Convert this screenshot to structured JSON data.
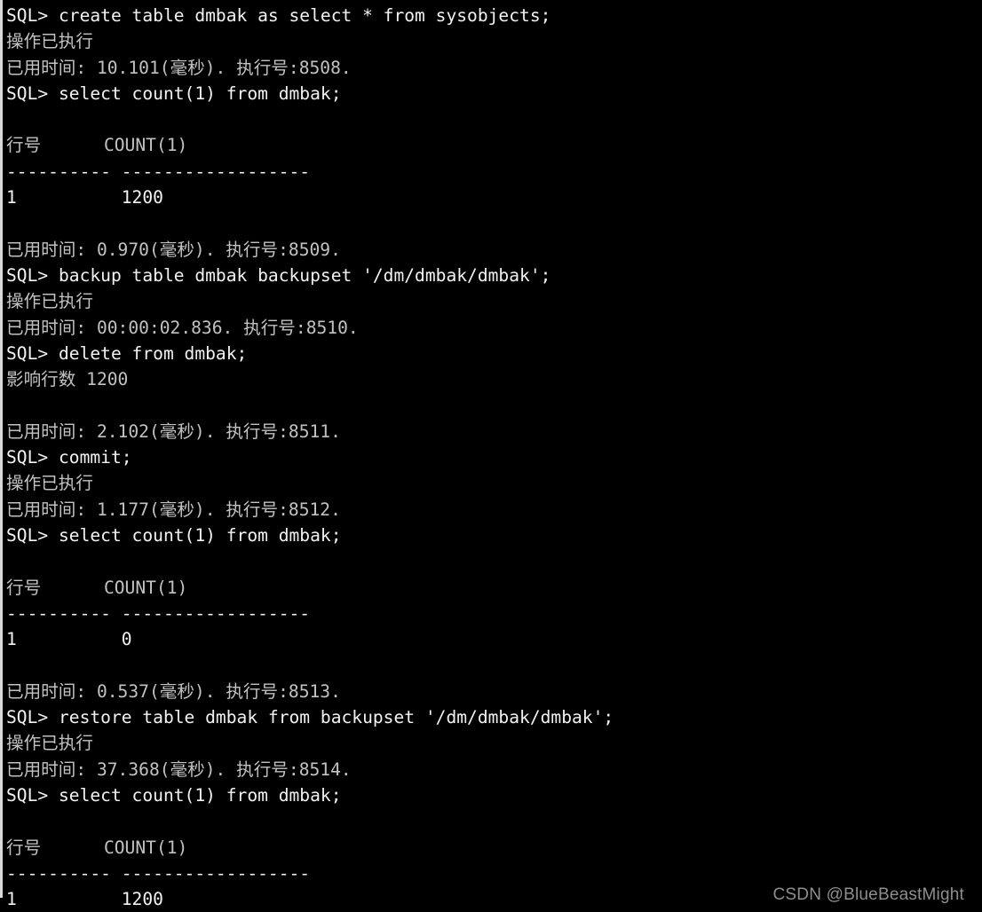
{
  "terminal": {
    "type": "dm-sql-console",
    "background_color": "#000000",
    "ascii_text_color": "#f2f2f2",
    "cjk_text_color": "#c2c2c2",
    "watermark_color": "#8e8e8e",
    "prompt": "SQL>",
    "labels": {
      "executed": "操作已执行",
      "elapsed_prefix": "已用时间:",
      "exec_id_prefix": "执行号:",
      "rows_affected": "影响行数",
      "col_rownum": "行号",
      "col_count": "COUNT(1)",
      "unit_ms": "(毫秒)"
    },
    "lines": [
      {
        "id": "l01",
        "kind": "command",
        "text": "SQL> create table dmbak as select * from sysobjects;"
      },
      {
        "id": "l02",
        "kind": "status",
        "text": "操作已执行"
      },
      {
        "id": "l03",
        "kind": "timing",
        "text": "已用时间: 10.101(毫秒). 执行号:8508."
      },
      {
        "id": "l04",
        "kind": "command",
        "text": "SQL> select count(1) from dmbak;"
      },
      {
        "id": "l05",
        "kind": "blank",
        "text": ""
      },
      {
        "id": "l06",
        "kind": "tableheader",
        "text": "行号      COUNT(1)"
      },
      {
        "id": "l07",
        "kind": "separator",
        "text": "---------- ------------------"
      },
      {
        "id": "l08",
        "kind": "tablerow",
        "text": "1          1200"
      },
      {
        "id": "l09",
        "kind": "blank",
        "text": ""
      },
      {
        "id": "l10",
        "kind": "timing",
        "text": "已用时间: 0.970(毫秒). 执行号:8509."
      },
      {
        "id": "l11",
        "kind": "command",
        "text": "SQL> backup table dmbak backupset '/dm/dmbak/dmbak';"
      },
      {
        "id": "l12",
        "kind": "status",
        "text": "操作已执行"
      },
      {
        "id": "l13",
        "kind": "timing",
        "text": "已用时间: 00:00:02.836. 执行号:8510."
      },
      {
        "id": "l14",
        "kind": "command",
        "text": "SQL> delete from dmbak;"
      },
      {
        "id": "l15",
        "kind": "status",
        "text": "影响行数 1200"
      },
      {
        "id": "l16",
        "kind": "blank",
        "text": ""
      },
      {
        "id": "l17",
        "kind": "timing",
        "text": "已用时间: 2.102(毫秒). 执行号:8511."
      },
      {
        "id": "l18",
        "kind": "command",
        "text": "SQL> commit;"
      },
      {
        "id": "l19",
        "kind": "status",
        "text": "操作已执行"
      },
      {
        "id": "l20",
        "kind": "timing",
        "text": "已用时间: 1.177(毫秒). 执行号:8512."
      },
      {
        "id": "l21",
        "kind": "command",
        "text": "SQL> select count(1) from dmbak;"
      },
      {
        "id": "l22",
        "kind": "blank",
        "text": ""
      },
      {
        "id": "l23",
        "kind": "tableheader",
        "text": "行号      COUNT(1)"
      },
      {
        "id": "l24",
        "kind": "separator",
        "text": "---------- ------------------"
      },
      {
        "id": "l25",
        "kind": "tablerow",
        "text": "1          0"
      },
      {
        "id": "l26",
        "kind": "blank",
        "text": ""
      },
      {
        "id": "l27",
        "kind": "timing",
        "text": "已用时间: 0.537(毫秒). 执行号:8513."
      },
      {
        "id": "l28",
        "kind": "command",
        "text": "SQL> restore table dmbak from backupset '/dm/dmbak/dmbak';"
      },
      {
        "id": "l29",
        "kind": "status",
        "text": "操作已执行"
      },
      {
        "id": "l30",
        "kind": "timing",
        "text": "已用时间: 37.368(毫秒). 执行号:8514."
      },
      {
        "id": "l31",
        "kind": "command",
        "text": "SQL> select count(1) from dmbak;"
      },
      {
        "id": "l32",
        "kind": "blank",
        "text": ""
      },
      {
        "id": "l33",
        "kind": "tableheader",
        "text": "行号      COUNT(1)"
      },
      {
        "id": "l34",
        "kind": "separator",
        "text": "---------- ------------------"
      },
      {
        "id": "l35",
        "kind": "tablerow",
        "text": "1          1200"
      }
    ],
    "statements": [
      {
        "exec_id": "8508",
        "sql": "create table dmbak as select * from sysobjects;",
        "result": "操作已执行",
        "elapsed": "10.101(毫秒)"
      },
      {
        "exec_id": "8509",
        "sql": "select count(1) from dmbak;",
        "result": "1200",
        "elapsed": "0.970(毫秒)"
      },
      {
        "exec_id": "8510",
        "sql": "backup table dmbak backupset '/dm/dmbak/dmbak';",
        "result": "操作已执行",
        "elapsed": "00:00:02.836"
      },
      {
        "exec_id": "8511",
        "sql": "delete from dmbak;",
        "result": "影响行数 1200",
        "elapsed": "2.102(毫秒)"
      },
      {
        "exec_id": "8512",
        "sql": "commit;",
        "result": "操作已执行",
        "elapsed": "1.177(毫秒)"
      },
      {
        "exec_id": "8513",
        "sql": "select count(1) from dmbak;",
        "result": "0",
        "elapsed": "0.537(毫秒)"
      },
      {
        "exec_id": "8514",
        "sql": "restore table dmbak from backupset '/dm/dmbak/dmbak';",
        "result": "操作已执行",
        "elapsed": "37.368(毫秒)"
      }
    ]
  },
  "watermark": {
    "text": "CSDN @BlueBeastMight"
  }
}
